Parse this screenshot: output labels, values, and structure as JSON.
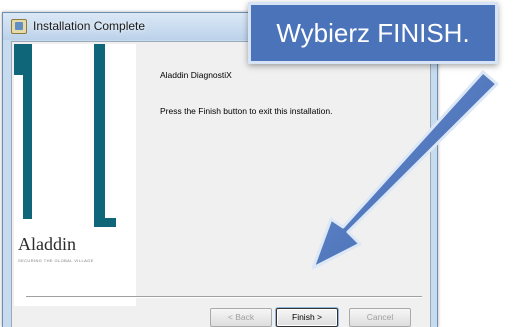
{
  "window": {
    "title": "Installation Complete"
  },
  "banner": {
    "logo_text": "Aladdin",
    "logo_tagline": "SECURING THE GLOBAL VILLAGE"
  },
  "content": {
    "heading": "Aladdin DiagnostiX",
    "message": "Press the Finish button to exit this installation."
  },
  "buttons": {
    "back_label": "< Back",
    "finish_label": "Finish >",
    "cancel_label": "Cancel"
  },
  "callout": {
    "text": "Wybierz FINISH.",
    "color": "#4a73ba"
  }
}
